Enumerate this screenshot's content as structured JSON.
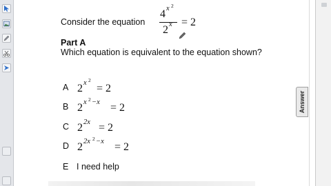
{
  "toolbar": {
    "icons": [
      "cursor-icon",
      "image-icon",
      "pencil-icon",
      "scissors-icon",
      "bookmark-icon"
    ]
  },
  "question": {
    "prompt": "Consider the equation",
    "equation": {
      "numerator_base": "4",
      "numerator_exp": "x",
      "numerator_exp_power": "2",
      "denominator_base": "2",
      "denominator_exp": "x",
      "rhs": "= 2"
    },
    "part_label": "Part A",
    "part_question": "Which equation is equivalent to the equation shown?"
  },
  "options": [
    {
      "letter": "A",
      "base": "2",
      "exp": "x",
      "exp_power": "2",
      "exp_rest": "",
      "rhs": "= 2"
    },
    {
      "letter": "B",
      "base": "2",
      "exp": "x",
      "exp_power": "2",
      "exp_rest": "−x",
      "rhs": "= 2"
    },
    {
      "letter": "C",
      "base": "2",
      "exp": "2x",
      "exp_power": "",
      "exp_rest": "",
      "rhs": "= 2"
    },
    {
      "letter": "D",
      "base": "2",
      "exp": "2x",
      "exp_power": "2",
      "exp_rest": "−x",
      "rhs": "= 2"
    },
    {
      "letter": "E",
      "text": "I need help"
    }
  ],
  "side_tab": {
    "label": "Answer"
  },
  "colors": {
    "toolbar_bg": "#e4e6ea",
    "accent_icon": "#2f6fc9"
  }
}
